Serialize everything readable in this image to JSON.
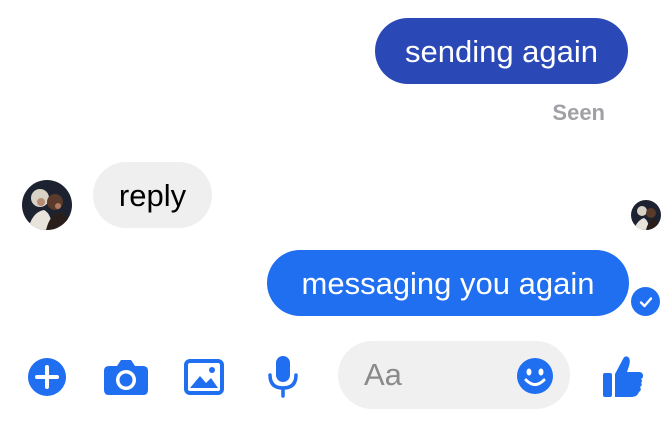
{
  "messages": [
    {
      "direction": "outgoing",
      "text": "sending again",
      "status": "Seen"
    },
    {
      "direction": "incoming",
      "text": "reply"
    },
    {
      "direction": "outgoing",
      "text": "messaging you again"
    }
  ],
  "composer": {
    "placeholder": "Aa"
  },
  "icons": {
    "add": "plus-circle-icon",
    "camera": "camera-icon",
    "gallery": "image-icon",
    "voice": "microphone-icon",
    "emoji": "smiley-icon",
    "like": "thumbs-up-icon",
    "delivered": "check-circle-icon"
  },
  "colors": {
    "accent": "#1f6ff0",
    "older_outgoing_bubble": "#2b49b6",
    "incoming_bubble": "#efefef",
    "seen_text": "#a0a0a5"
  }
}
